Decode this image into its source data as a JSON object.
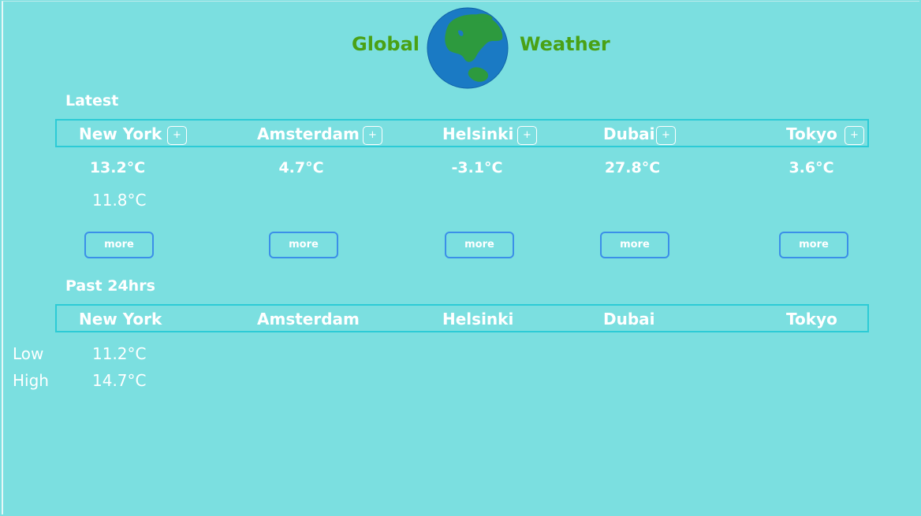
{
  "header": {
    "title_left": "Global",
    "title_right": "Weather",
    "logo_icon": "globe-icon",
    "title_color": "#4aa115"
  },
  "latest": {
    "label": "Latest",
    "plus_label": "+",
    "more_label": "more",
    "cities": [
      {
        "name": "New York",
        "temp": "13.2°C",
        "secondary_temp": "11.8°C"
      },
      {
        "name": "Amsterdam",
        "temp": "4.7°C"
      },
      {
        "name": "Helsinki",
        "temp": "-3.1°C"
      },
      {
        "name": "Dubai",
        "temp": "27.8°C"
      },
      {
        "name": "Tokyo",
        "temp": "3.6°C"
      }
    ]
  },
  "past24": {
    "label": "Past 24hrs",
    "cities": [
      "New York",
      "Amsterdam",
      "Helsinki",
      "Dubai",
      "Tokyo"
    ],
    "low_label": "Low",
    "high_label": "High",
    "new_york": {
      "low": "11.2°C",
      "high": "14.7°C"
    }
  },
  "colors": {
    "background": "#7bdfe0",
    "bar_border": "#2ccbd6",
    "button_border": "#3b8fe8",
    "text": "#ffffff"
  }
}
